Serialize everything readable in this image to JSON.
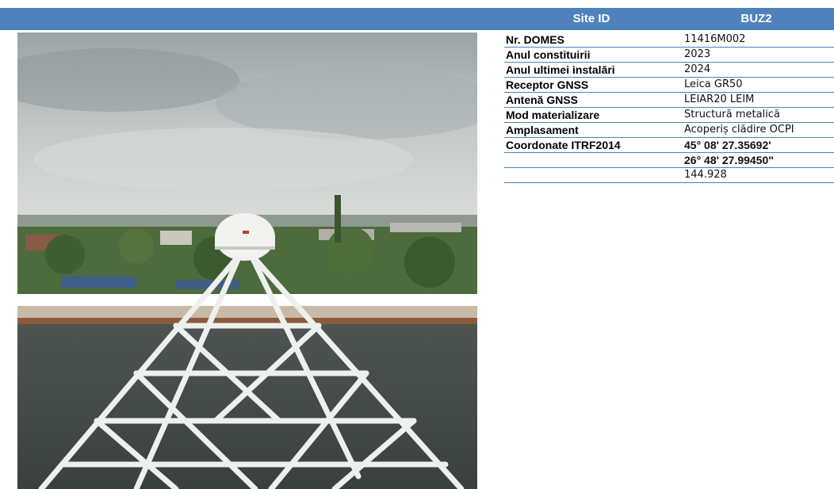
{
  "header": {
    "site_label": "Site ID",
    "site_value": "BUZ2"
  },
  "photo": {
    "subject": "GNSS antenna on white metal truss structure on rooftop"
  },
  "rows": [
    {
      "key": "Nr. DOMES",
      "value": "11416M002"
    },
    {
      "key": "Anul constituirii",
      "value": "2023"
    },
    {
      "key": "Anul ultimei instalări",
      "value": "2024"
    },
    {
      "key": "Receptor GNSS",
      "value": "Leica GR50"
    },
    {
      "key": "Antenă GNSS",
      "value": "LEIAR20 LEIM"
    },
    {
      "key": "Mod materializare",
      "value": "Structură metalică"
    },
    {
      "key": "Amplasament",
      "value": "Acoperiș clădire OCPI"
    },
    {
      "key": "Coordonate ITRF2014",
      "value": "45° 08' 27.35692'"
    },
    {
      "key": "",
      "value": "26° 48' 27.99450\""
    },
    {
      "key": "",
      "value": "144.928"
    }
  ],
  "colors": {
    "accent": "#4f81bd"
  }
}
